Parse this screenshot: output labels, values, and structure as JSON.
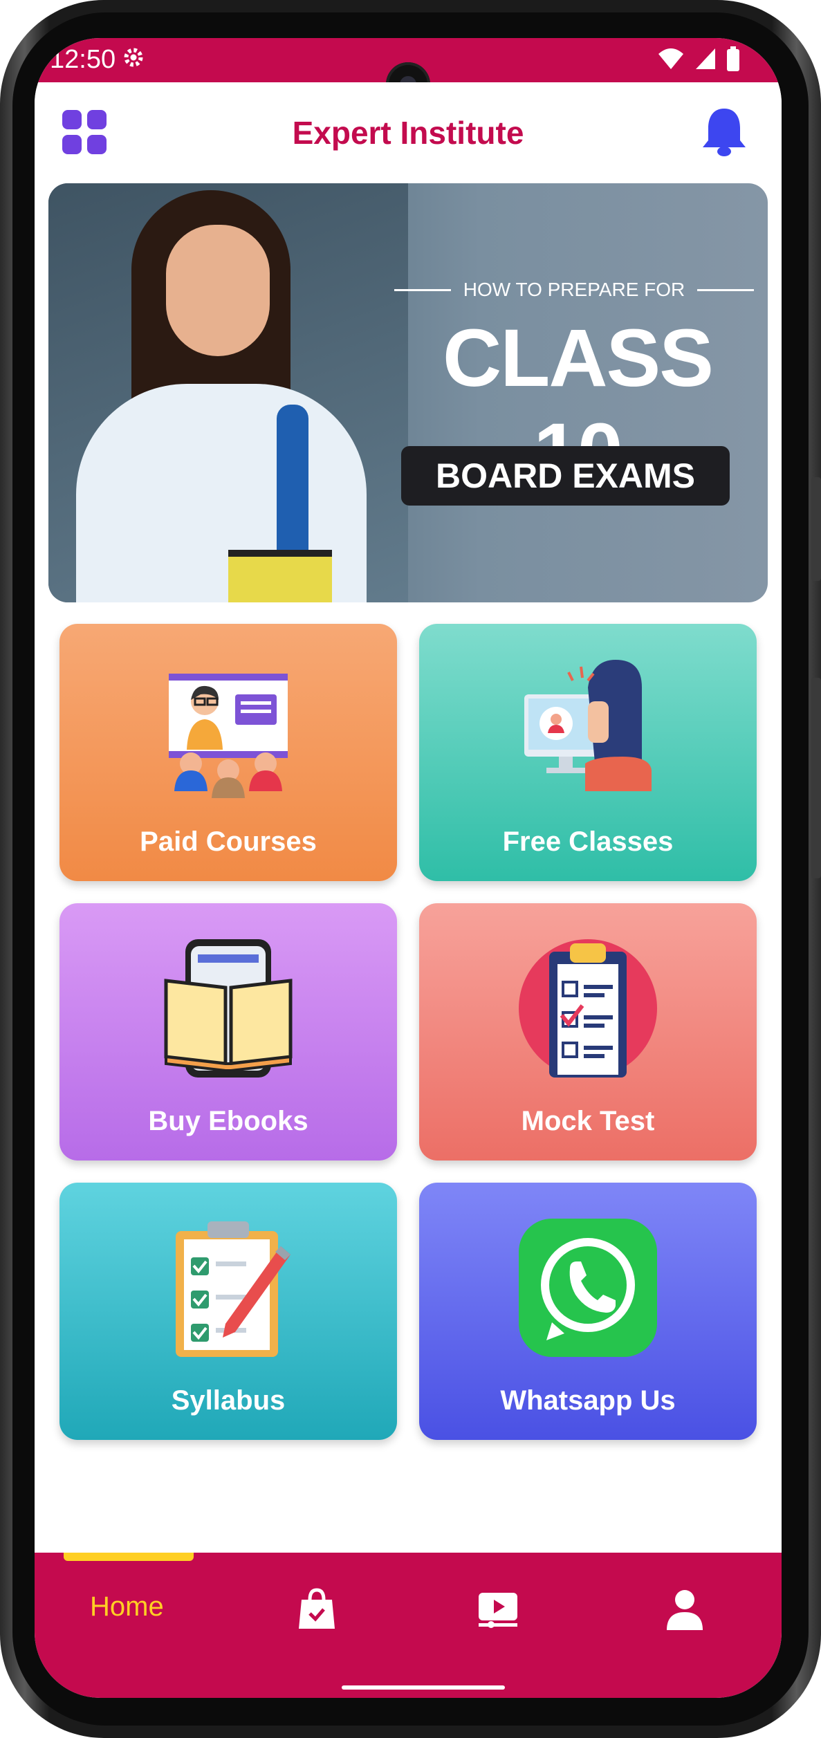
{
  "status_bar": {
    "time": "12:50"
  },
  "app_bar": {
    "title": "Expert Institute"
  },
  "banner": {
    "subtitle": "HOW TO PREPARE FOR",
    "headline": "CLASS 10",
    "pill": "BOARD EXAMS"
  },
  "tiles": [
    {
      "label": "Paid Courses"
    },
    {
      "label": "Free Classes"
    },
    {
      "label": "Buy Ebooks"
    },
    {
      "label": "Mock Test"
    },
    {
      "label": "Syllabus"
    },
    {
      "label": "Whatsapp Us"
    }
  ],
  "bottom_nav": {
    "home_label": "Home",
    "items": [
      "home",
      "shopping-bag-icon",
      "video-icon",
      "profile-icon"
    ]
  },
  "colors": {
    "brand": "#c40a4e",
    "accent": "#ffcf24",
    "menu_icon": "#7040e0"
  }
}
